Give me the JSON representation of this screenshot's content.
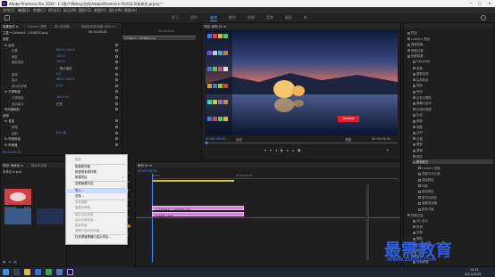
{
  "window": {
    "title": "Adobe Premiere Pro 2020 - C:\\用户\\Pbhsy\\文档\\Adobe\\Premiere Pro\\14.0\\未命名.prproj *",
    "app_icon": "Pr",
    "controls": [
      "—",
      "□",
      "✕"
    ]
  },
  "menu": [
    "文件(F)",
    "编辑(E)",
    "剪辑(C)",
    "序列(S)",
    "标记(M)",
    "图形(G)",
    "视图(V)",
    "窗口(W)",
    "帮助(H)"
  ],
  "workspaces": {
    "items": [
      "学习",
      "组件",
      "编辑",
      "颜色",
      "效果",
      "音频",
      "图形",
      "库"
    ],
    "active_index": 2
  },
  "effect_controls": {
    "tabs": [
      "效果控件 ≡",
      "Lumetri 范围",
      "源:(无剪辑)",
      "音频剪辑混合器: 序列 01"
    ],
    "header": "主要 * 1b5a9e7...1026f24.png",
    "time": "00:00:05;00",
    "sections": [
      {
        "label": "视频",
        "kind": "heading"
      },
      {
        "label": "fx 运动",
        "kind": "fx"
      },
      {
        "label": "位置",
        "value": "960.0  540.0"
      },
      {
        "label": "缩放",
        "value": "100.0"
      },
      {
        "label": "缩放宽度",
        "value": "100.0"
      },
      {
        "label": "",
        "value": "✓ 等比缩放"
      },
      {
        "label": "旋转",
        "value": "0.0"
      },
      {
        "label": "锚点",
        "value": "960.0  540.0"
      },
      {
        "label": "防闪烁滤镜",
        "value": "0.00"
      },
      {
        "label": "fx 不透明度",
        "kind": "fx"
      },
      {
        "label": "不透明度",
        "value": "100.0 %"
      },
      {
        "label": "混合模式",
        "value": "正常"
      },
      {
        "label": "时间重映射",
        "kind": "fx"
      },
      {
        "label": "音频",
        "kind": "heading"
      },
      {
        "label": "fx 音量",
        "kind": "fx"
      },
      {
        "label": "旁路",
        "value": ""
      },
      {
        "label": "级别",
        "value": "0.0 dB"
      },
      {
        "label": "fx 声道音量",
        "kind": "fx"
      },
      {
        "label": "fx 声像器",
        "kind": "fx"
      }
    ],
    "footer_time": "00:00:00:00"
  },
  "clip_thumbnail": {
    "name": "1b5a9e7...1026f24.png",
    "ruler": "00:00:00:00"
  },
  "program": {
    "tab": "节目: 序列 01 ≡",
    "timecode": "00:00:00;00",
    "fit": "适合",
    "quality": "完整",
    "duration": "00:00:05;00",
    "badge": "Lenovo"
  },
  "project": {
    "tabs": [
      "项目: 未命名 ≡",
      "媒体浏览器",
      "库",
      "信息"
    ],
    "file": "未命名.prproj",
    "items": [
      {
        "name": "1b5a9e7…",
        "dur": "5:00"
      },
      {
        "name": "1b5a9e7…",
        "dur": "5:00"
      },
      {
        "name": "序列 01",
        "dur": "5:00"
      },
      {
        "name": "2a3c…",
        "dur": "5:00"
      }
    ]
  },
  "context_menu": {
    "items": [
      {
        "label": "粘贴",
        "disabled": true
      },
      {
        "label": "新建素材箱",
        "disabled": false
      },
      {
        "label": "新建搜索素材箱",
        "disabled": false
      },
      {
        "label": "新建项目",
        "disabled": false,
        "submenu": true
      },
      {
        "label": "查看隐藏内容",
        "disabled": false
      },
      {
        "label": "导入...",
        "disabled": false,
        "highlighted": true
      },
      {
        "label": "查找...",
        "disabled": false
      },
      {
        "label": "对齐网格",
        "disabled": true
      },
      {
        "label": "重置为网格",
        "disabled": true
      },
      {
        "label": "保存当前布局",
        "disabled": true
      },
      {
        "label": "另存为新布局...",
        "disabled": true
      },
      {
        "label": "恢复布局",
        "disabled": true
      },
      {
        "label": "管理已保存的布局...",
        "disabled": true
      },
      {
        "label": "在资源管理器中显示项目...",
        "disabled": false
      }
    ]
  },
  "timeline": {
    "tab": "序列 01 ≡",
    "timecode": "00:00:00:00",
    "ruler": [
      "00:00",
      "00:00:05:00"
    ],
    "clips": [
      {
        "label": "fx 1b5a9e7…1026f24.png"
      },
      {
        "label": "fx 2a3c…png"
      }
    ]
  },
  "effects_panel": {
    "items": [
      {
        "label": "预设",
        "level": 0
      },
      {
        "label": "Lumetri 预设",
        "level": 0
      },
      {
        "label": "音频效果",
        "level": 0
      },
      {
        "label": "音频过渡",
        "level": 0
      },
      {
        "label": "视频效果",
        "level": 0
      },
      {
        "label": "Obsolete",
        "level": 1
      },
      {
        "label": "变换",
        "level": 1
      },
      {
        "label": "图像控制",
        "level": 1
      },
      {
        "label": "实用程序",
        "level": 1
      },
      {
        "label": "扭曲",
        "level": 1
      },
      {
        "label": "时间",
        "level": 1
      },
      {
        "label": "杂色与颗粒",
        "level": 1
      },
      {
        "label": "模糊与锐化",
        "level": 1
      },
      {
        "label": "沉浸式视频",
        "level": 1
      },
      {
        "label": "生成",
        "level": 1
      },
      {
        "label": "视频",
        "level": 1
      },
      {
        "label": "调整",
        "level": 1
      },
      {
        "label": "过时",
        "level": 1
      },
      {
        "label": "过渡",
        "level": 1
      },
      {
        "label": "透视",
        "level": 1
      },
      {
        "label": "通道",
        "level": 1
      },
      {
        "label": "键控",
        "level": 1
      },
      {
        "label": "颜色校正",
        "level": 1,
        "selected": true
      },
      {
        "label": "Lumetri 颜色",
        "level": 2
      },
      {
        "label": "亮度与对比度",
        "level": 2
      },
      {
        "label": "保留颜色",
        "level": 2
      },
      {
        "label": "均衡",
        "level": 2
      },
      {
        "label": "更改颜色",
        "level": 2
      },
      {
        "label": "更改为颜色",
        "level": 2
      },
      {
        "label": "通道混合器",
        "level": 2
      },
      {
        "label": "颜色平衡",
        "level": 2
      },
      {
        "label": "视频过渡",
        "level": 0
      },
      {
        "label": "3D 运动",
        "level": 1
      },
      {
        "label": "内滑",
        "level": 1
      },
      {
        "label": "划像",
        "level": 1
      },
      {
        "label": "擦除",
        "level": 1
      },
      {
        "label": "沉浸式视频",
        "level": 1
      },
      {
        "label": "溶解",
        "level": 1
      },
      {
        "label": "缩放",
        "level": 1
      },
      {
        "label": "页面剥落",
        "level": 1
      }
    ]
  },
  "watermark": {
    "main": "最需教育",
    "sub": "WWW.ZUIXU.COM"
  },
  "taskbar": {
    "clock": "13:21",
    "date": "2021/10/29"
  },
  "colors": {
    "accent": "#4d90ff",
    "clip": "#d47fd9",
    "watermark": "#2f5fe0"
  }
}
